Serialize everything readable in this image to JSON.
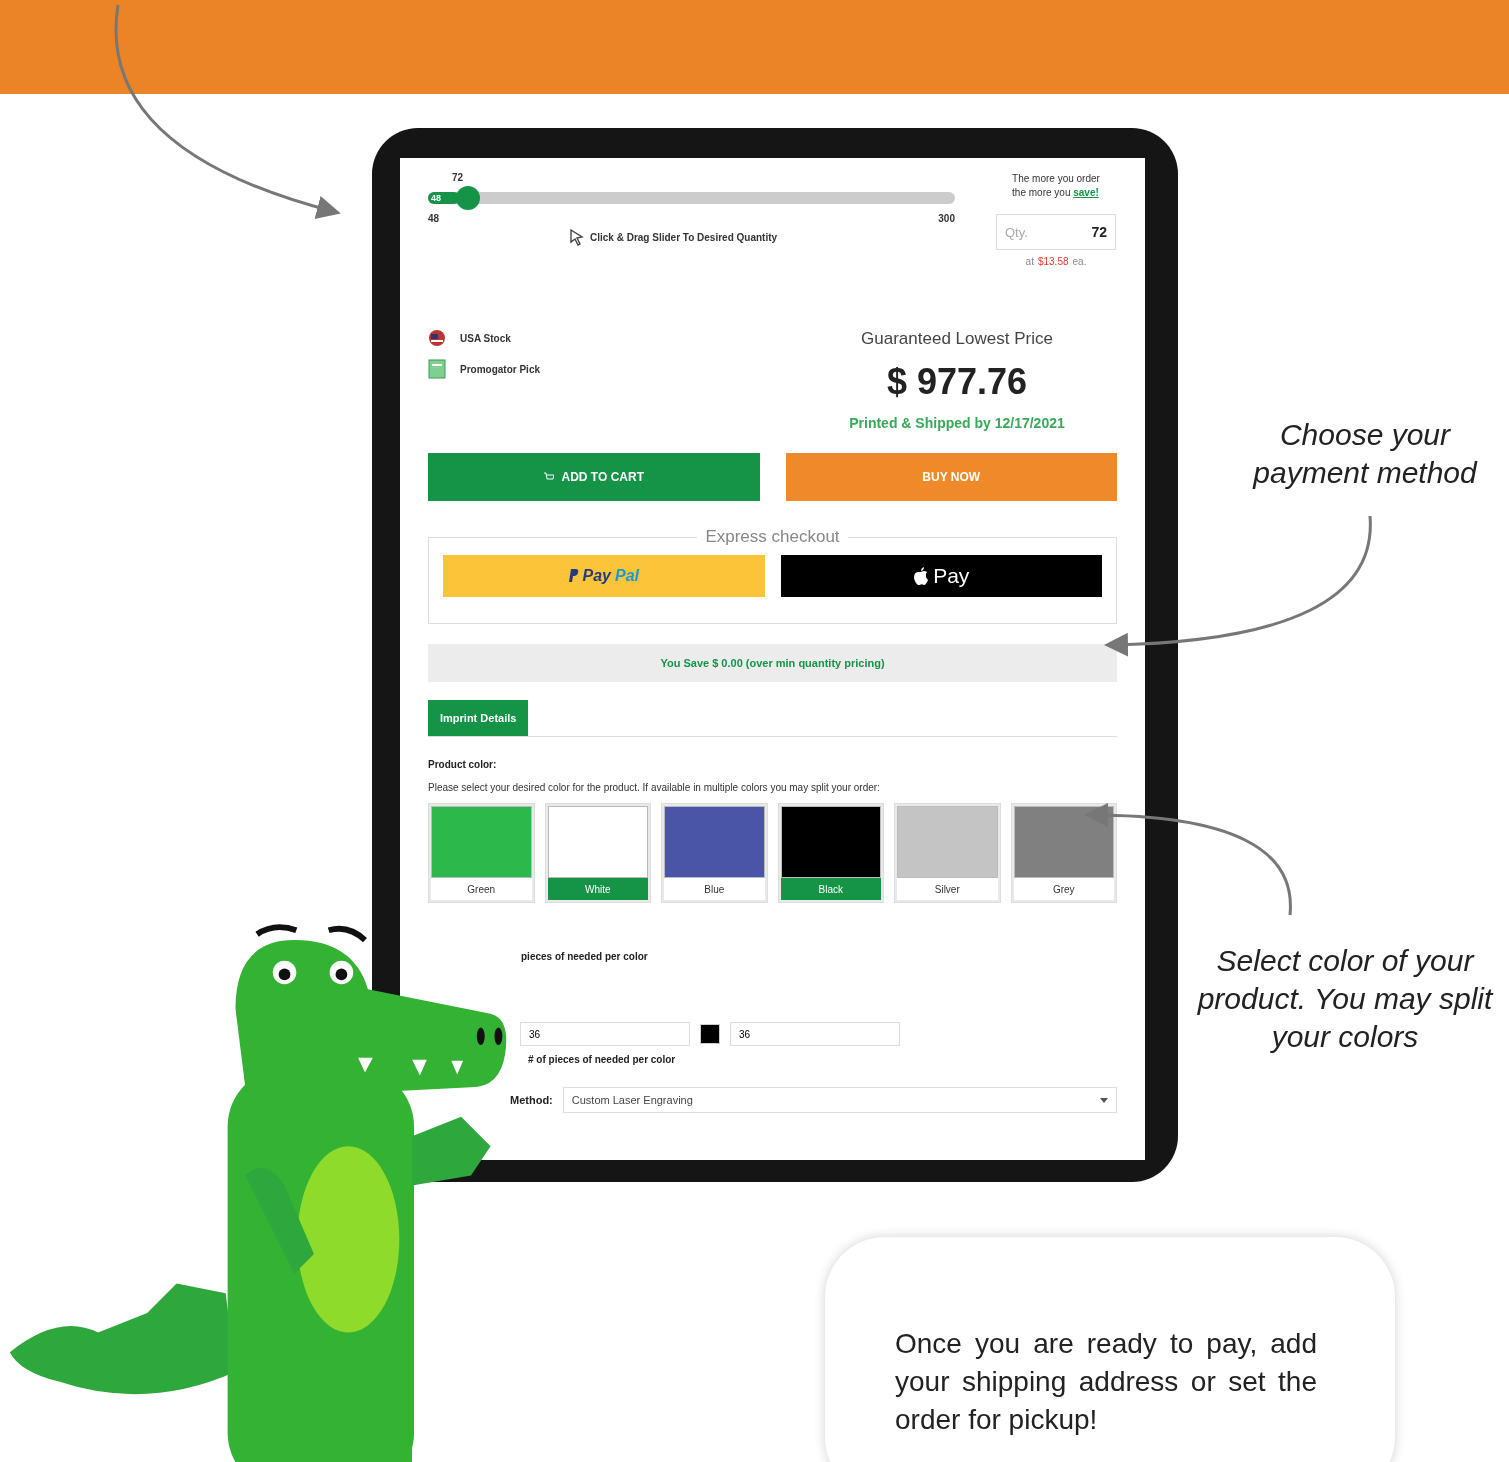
{
  "slider": {
    "value_label": "72",
    "fill_label": "48",
    "min_label": "48",
    "max_label": "300",
    "level": 0.06,
    "hint": "Click & Drag Slider To Desired Quantity"
  },
  "savings_note": {
    "line_1": "The more you order",
    "line_2": "the more you ",
    "link": "save!"
  },
  "qty_field": {
    "label": "Qty.",
    "value": "72"
  },
  "unit_price": {
    "prefix": "at",
    "price": "$13.58",
    "suffix": "ea."
  },
  "badges": [
    {
      "kind": "flag",
      "label": "USA Stock"
    },
    {
      "kind": "pick",
      "label": "Promogator Pick"
    }
  ],
  "price_box": {
    "heading": "Guaranteed Lowest Price",
    "price": "$ 977.76",
    "shipping": "Printed & Shipped by 12/17/2021"
  },
  "buttons": [
    {
      "kind": "cart",
      "label": "ADD TO CART"
    },
    {
      "kind": "buy",
      "label": "BUY NOW"
    }
  ],
  "express_checkout": {
    "title": "Express checkout",
    "options": [
      {
        "kind": "paypal",
        "label_1": "Pay",
        "label_2": "Pal"
      },
      {
        "kind": "applepay",
        "label_1": "Pay"
      }
    ]
  },
  "savings_bar": "You Save $ 0.00 (over min quantity pricing)",
  "tabs": [
    {
      "label": "Imprint Details",
      "selected": true
    }
  ],
  "product_color": {
    "heading": "Product color:",
    "instructions": "Please select your desired color for the product. If available in multiple colors you may split your order:",
    "colors": [
      {
        "label": "Green",
        "color": "#2db84b",
        "selected": false
      },
      {
        "label": "White",
        "color": "#ffffff",
        "selected": true
      },
      {
        "label": "Blue",
        "color": "#4a55a8",
        "selected": false
      },
      {
        "label": "Black",
        "color": "#000000",
        "selected": true
      },
      {
        "label": "Silver",
        "color": "#c4c4c4",
        "selected": false
      },
      {
        "label": "Grey",
        "color": "#808080",
        "selected": false
      }
    ]
  },
  "quantity_rows": {
    "note_1": "pieces of needed per color",
    "inputs": [
      {
        "value": "36",
        "color": "#ffffff"
      },
      {
        "value": "36",
        "color": "#000000"
      }
    ],
    "note_2": "# of pieces of needed per color"
  },
  "imprint_method": {
    "label": "Method:",
    "value": "Custom Laser Engraving"
  },
  "callouts": [
    "Choose your payment method",
    "Select color of your product. You may split your colors"
  ],
  "info_card": "Once you are ready to pay, add your shipping address or set the order for pickup!"
}
